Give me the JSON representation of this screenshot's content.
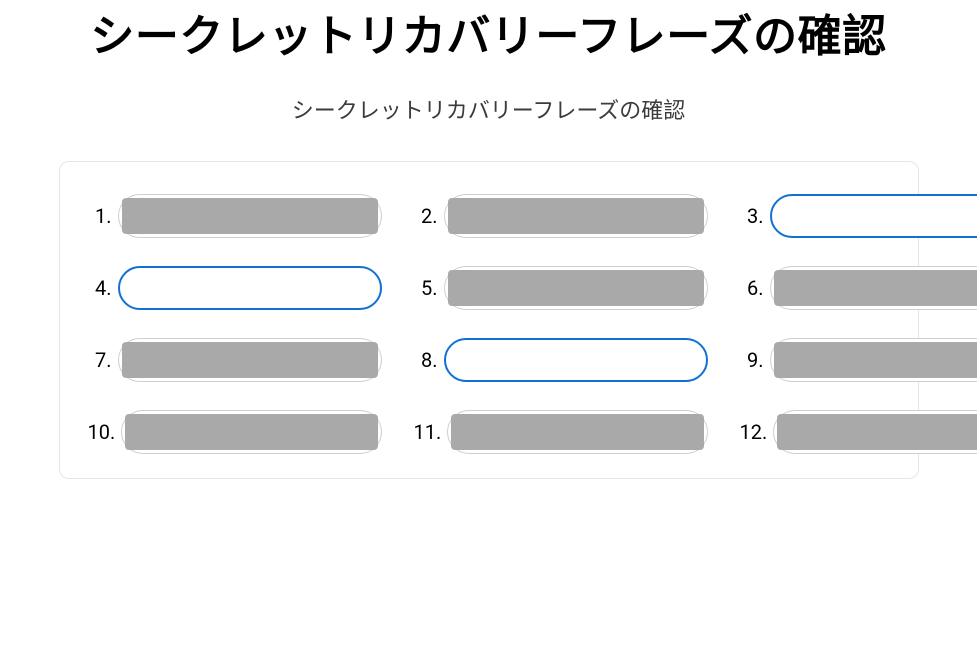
{
  "title": "シークレットリカバリーフレーズの確認",
  "subtitle": "シークレットリカバリーフレーズの確認",
  "colors": {
    "accent": "#1071d3",
    "mask": "#a9a9a9",
    "border": "#e5e5e5"
  },
  "words": [
    {
      "index": 1,
      "label": "1.",
      "editable": false,
      "focused": false,
      "value": ""
    },
    {
      "index": 2,
      "label": "2.",
      "editable": false,
      "focused": false,
      "value": ""
    },
    {
      "index": 3,
      "label": "3.",
      "editable": true,
      "focused": true,
      "value": ""
    },
    {
      "index": 4,
      "label": "4.",
      "editable": true,
      "focused": false,
      "value": ""
    },
    {
      "index": 5,
      "label": "5.",
      "editable": false,
      "focused": false,
      "value": ""
    },
    {
      "index": 6,
      "label": "6.",
      "editable": false,
      "focused": false,
      "value": ""
    },
    {
      "index": 7,
      "label": "7.",
      "editable": false,
      "focused": false,
      "value": ""
    },
    {
      "index": 8,
      "label": "8.",
      "editable": true,
      "focused": false,
      "value": ""
    },
    {
      "index": 9,
      "label": "9.",
      "editable": false,
      "focused": false,
      "value": ""
    },
    {
      "index": 10,
      "label": "10.",
      "editable": false,
      "focused": false,
      "value": ""
    },
    {
      "index": 11,
      "label": "11.",
      "editable": false,
      "focused": false,
      "value": ""
    },
    {
      "index": 12,
      "label": "12.",
      "editable": false,
      "focused": false,
      "value": ""
    }
  ]
}
